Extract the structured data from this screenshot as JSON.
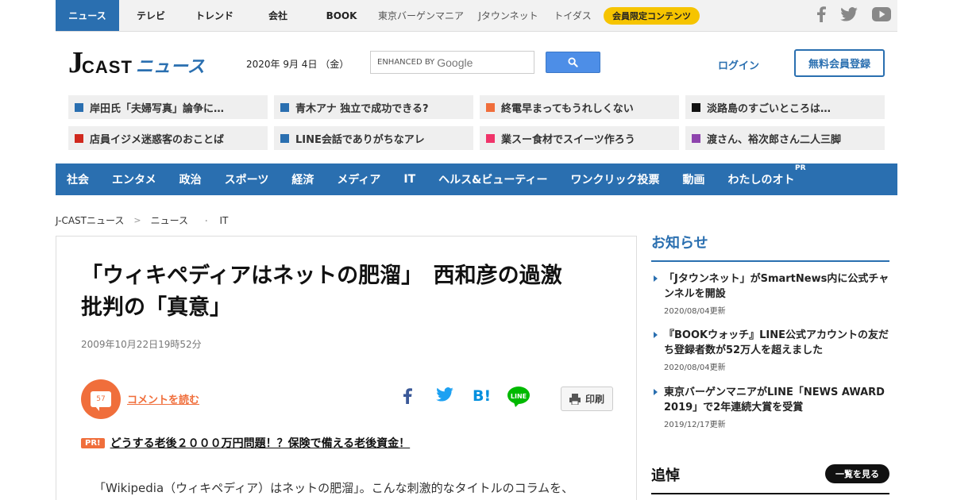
{
  "topnav": {
    "items": [
      {
        "label": "ニュース",
        "active": true
      },
      {
        "label": "テレビ"
      },
      {
        "label": "トレンド"
      },
      {
        "label": "会社"
      },
      {
        "label": "BOOK"
      },
      {
        "label": "東京バーゲンマニア"
      },
      {
        "label": "Jタウンネット"
      },
      {
        "label": "トイダス"
      }
    ],
    "members_label": "会員限定コンテンツ",
    "social_icons": [
      "facebook-icon",
      "twitter-icon",
      "youtube-icon"
    ]
  },
  "header": {
    "logo_j": "J",
    "logo_cast": "CAST",
    "logo_news": "ニュース",
    "date": "2020年 9月 4日 （金）",
    "search_prefix": "ENHANCED BY",
    "search_brand": "Google",
    "login_label": "ログイン",
    "register_label": "無料会員登録"
  },
  "topics": [
    {
      "label": "岸田氏「夫婦写真」論争に…",
      "color": "#2a6fb0"
    },
    {
      "label": "青木アナ 独立で成功できる?",
      "color": "#2a6fb0"
    },
    {
      "label": "終電早まってもうれしくない",
      "color": "#f06e3b"
    },
    {
      "label": "淡路島のすごいところは…",
      "color": "#111111"
    },
    {
      "label": "店員イジメ迷惑客のおことば",
      "color": "#d0291e"
    },
    {
      "label": "LINE会話でありがちなアレ",
      "color": "#2a6fb0"
    },
    {
      "label": "業スー食材でスイーツ作ろう",
      "color": "#f0346a"
    },
    {
      "label": "渡さん、裕次郎さん二人三脚",
      "color": "#8e44ad"
    }
  ],
  "mainnav": {
    "items": [
      "社会",
      "エンタメ",
      "政治",
      "スポーツ",
      "経済",
      "メディア",
      "IT",
      "ヘルス&ビューティー",
      "ワンクリック投票",
      "動画",
      "わたしのオト"
    ],
    "pr_badge": "PR"
  },
  "breadcrumb": {
    "items": [
      "J-CASTニュース",
      "ニュース",
      "IT"
    ],
    "sep1": ">",
    "sep2": "･"
  },
  "article": {
    "title_line1": "「ウィキペディアはネットの肥溜」　西和彦の過激",
    "title_line2": "批判の「真意」",
    "date": "2009年10月22日19時52分",
    "comment_count": "57",
    "comment_link": "コメントを読む",
    "print_label": "印刷",
    "pr_tag": "PR!",
    "pr_text": "どうする老後２０００万円問題！？保険で備える老後資金！",
    "lead": "「Wikipedia（ウィキペディア）はネットの肥溜」。こんな刺激的なタイトルのコラムを、"
  },
  "sidebar": {
    "notice_title": "お知らせ",
    "notices": [
      {
        "title": "「Jタウンネット」がSmartNews内に公式チャンネルを開設",
        "updated": "2020/08/04更新"
      },
      {
        "title": "『BOOKウォッチ』LINE公式アカウントの友だち登録者数が52万人を超えました",
        "updated": "2020/08/04更新"
      },
      {
        "title": "東京バーゲンマニアがLINE「NEWS AWARD 2019」で2年連続大賞を受賞",
        "updated": "2019/12/17更新"
      }
    ],
    "memorial_title": "追悼",
    "more_label": "一覧を見る"
  },
  "colors": {
    "brand_blue": "#2a6fb0",
    "accent_orange": "#f06e3b",
    "members_yellow": "#f6c400"
  }
}
